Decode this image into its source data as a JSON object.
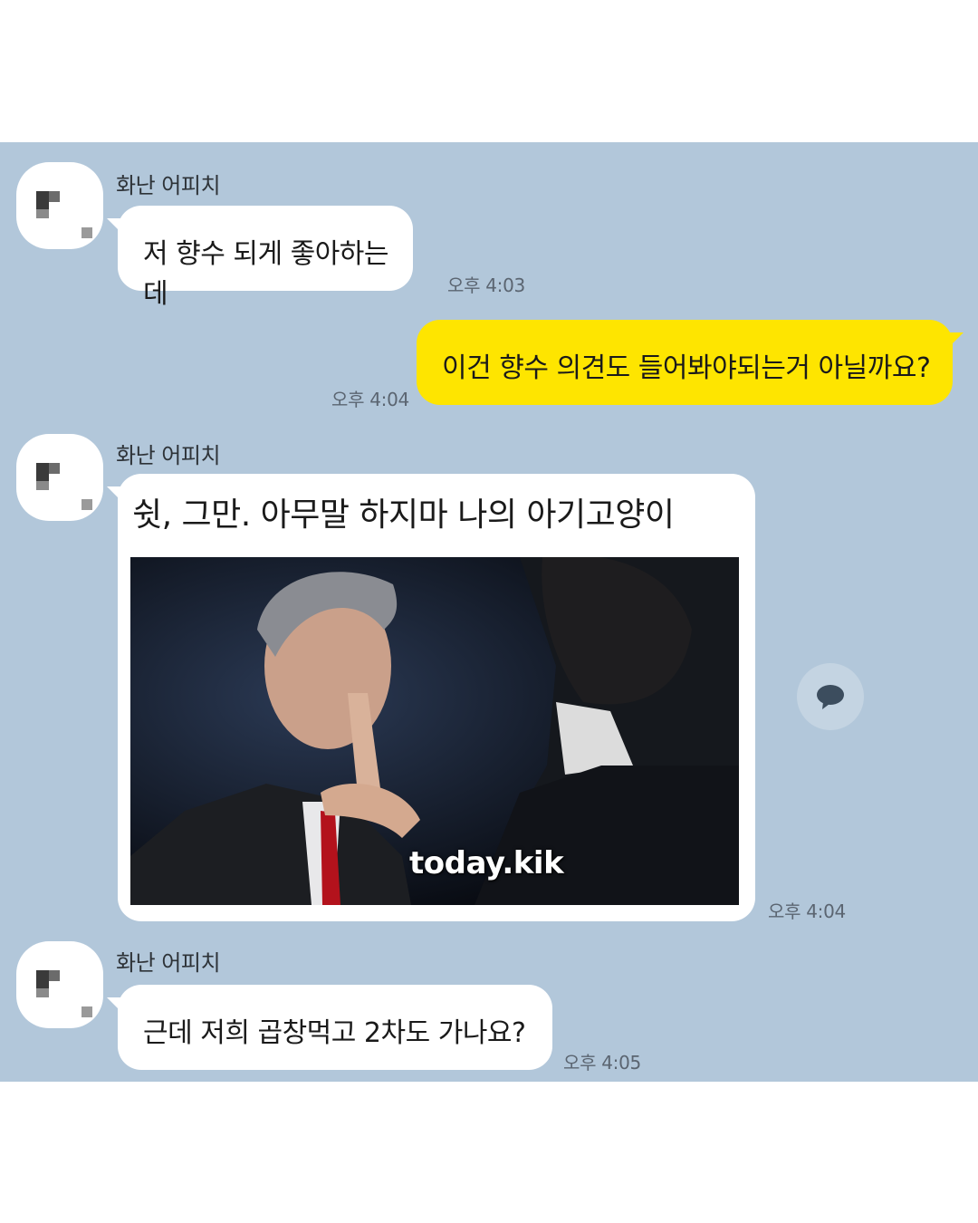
{
  "messages": [
    {
      "sender": "화난 어피치",
      "text": "저 향수 되게 좋아하는데",
      "time": "오후 4:03"
    },
    {
      "text": "이건 향수 의견도 들어봐야되는거 아닐까요?",
      "time": "오후 4:04"
    },
    {
      "sender": "화난 어피치",
      "text": "쉿, 그만. 아무말 하지마 나의 아기고양이",
      "watermark": "today.kik",
      "time": "오후 4:04"
    },
    {
      "sender": "화난 어피치",
      "text": "근데 저희 곱창먹고 2차도 가나요?",
      "time": "오후 4:05"
    }
  ],
  "colors": {
    "chat_background": "#b2c7da",
    "incoming_bubble": "#ffffff",
    "outgoing_bubble": "#fee500"
  },
  "icons": {
    "share": "speech-bubble-icon"
  }
}
